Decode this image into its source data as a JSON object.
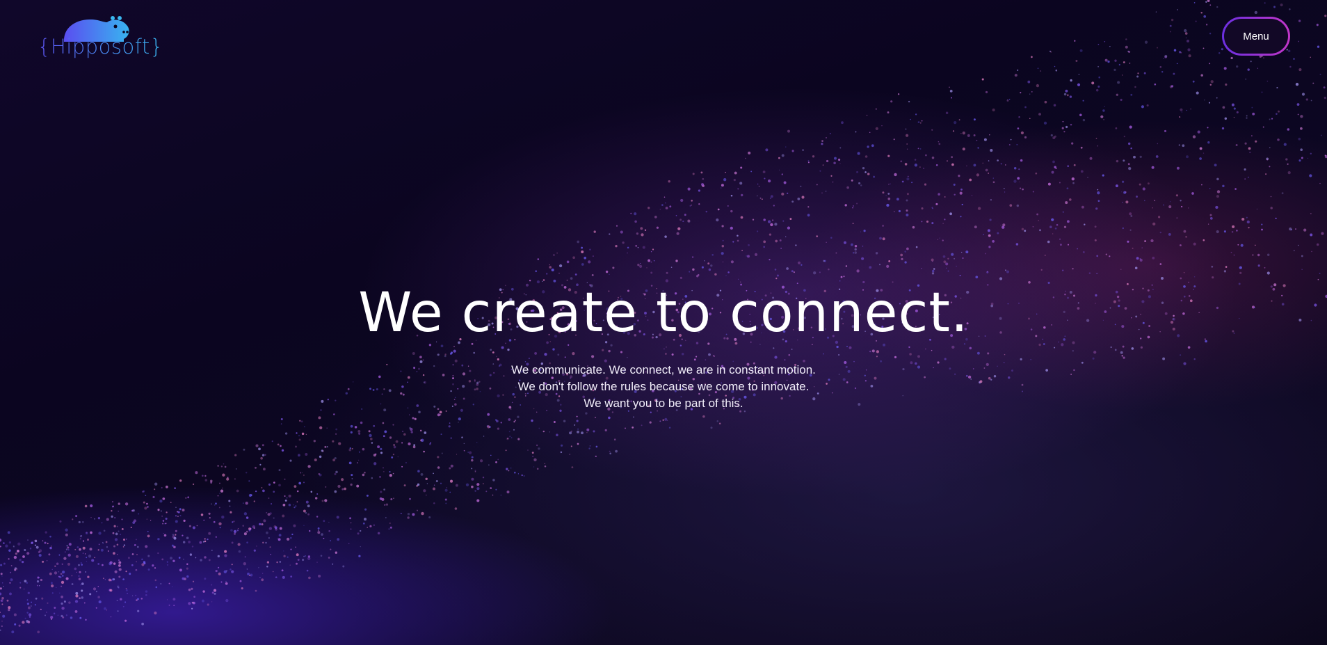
{
  "brand": {
    "name": "Hipposoft",
    "logo_text": "{Hipposoft}",
    "mascot_icon": "hippo-icon",
    "colors": {
      "gradient_start": "#5b52f0",
      "gradient_end": "#39b7f0"
    }
  },
  "header": {
    "menu_label": "Menu",
    "menu_border_colors": [
      "#6b2fe0",
      "#c236c8"
    ]
  },
  "hero": {
    "title": "We create to connect.",
    "lines": [
      "We communicate. We connect, we are in constant motion.",
      "We don't follow the rules because we come to innovate.",
      "We want you to be part of this."
    ]
  },
  "background": {
    "description_icon": "particle-wave-background",
    "colors": {
      "base": "#0b0520",
      "purple": "#8a3ad0",
      "blue": "#4a30e8",
      "magenta": "#b03080"
    }
  }
}
